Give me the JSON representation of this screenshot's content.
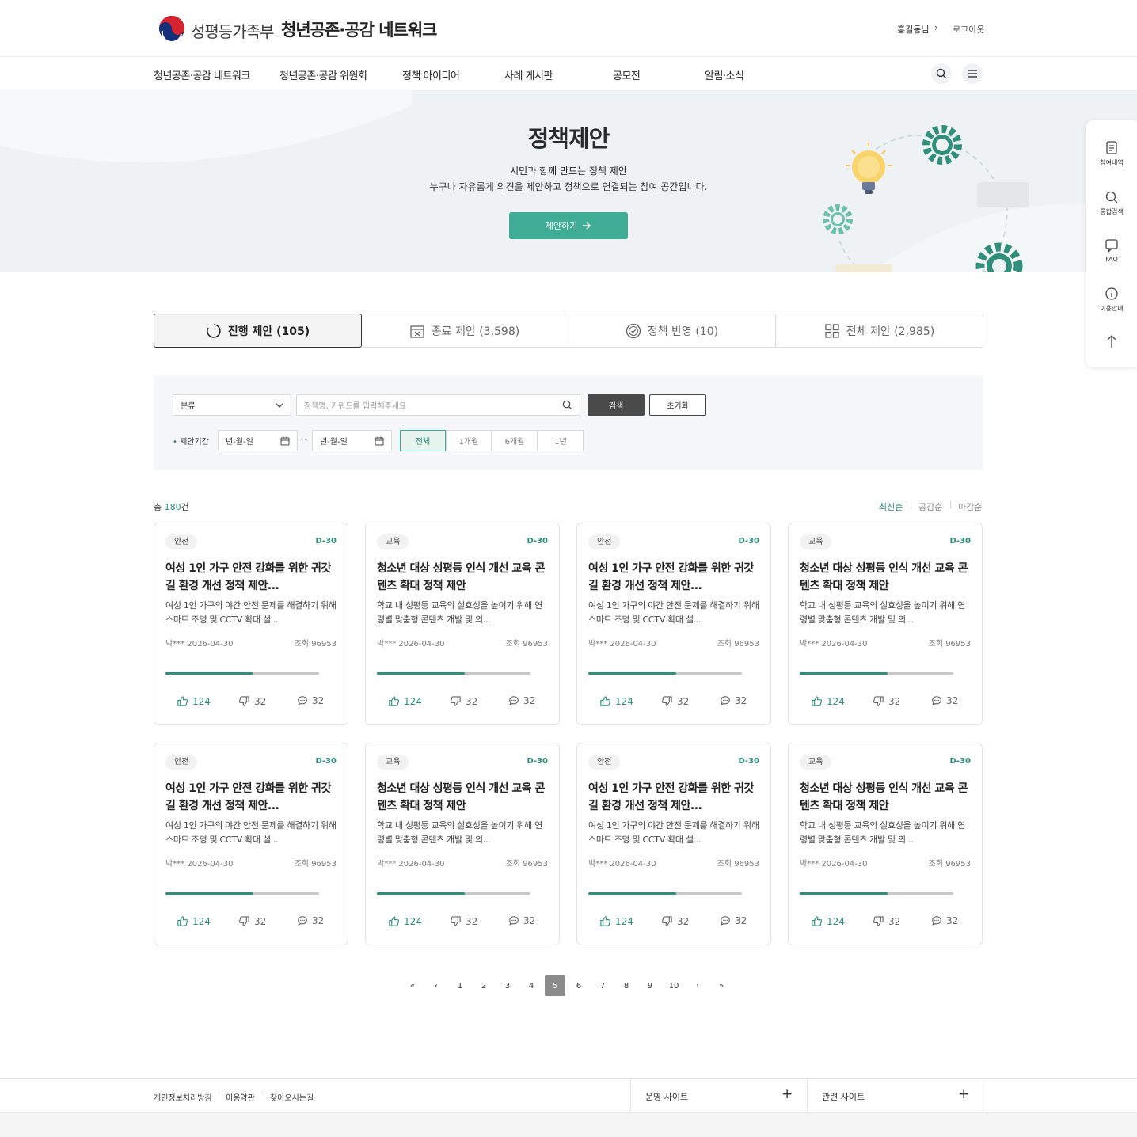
{
  "header": {
    "ministry": "성평등가족부",
    "site_title": "청년공존·공감 네트워크",
    "user": "홍길동님",
    "logout": "로그아웃"
  },
  "nav": {
    "items": [
      "청년공존·공감 네트워크",
      "청년공존·공감 위원회",
      "정책 아이디어",
      "사례 게시판",
      "공모전",
      "알림·소식"
    ]
  },
  "hero": {
    "title": "정책제안",
    "sub1": "시민과 함께 만드는 정책 제안",
    "sub2": "누구나 자유롭게 의견을 제안하고 정책으로 연결되는 참여 공간입니다.",
    "button": "제안하기"
  },
  "quick": {
    "items": [
      "참여내역",
      "통합검색",
      "FAQ",
      "이용안내"
    ]
  },
  "tabs": [
    {
      "label": "진행 제안 (105)",
      "icon": "progress-icon"
    },
    {
      "label": "종료 제안 (3,598)",
      "icon": "calendar-close-icon"
    },
    {
      "label": "정책 반영 (10)",
      "icon": "check-circle-icon"
    },
    {
      "label": "전체 제안 (2,985)",
      "icon": "grid-icon"
    }
  ],
  "search": {
    "category": "분류",
    "placeholder": "정책명, 키워드를 입력해주세요",
    "search_btn": "검색",
    "reset_btn": "초기화",
    "period_label": "제안기간",
    "date_from": "년-월-일",
    "tilde": "~",
    "date_to": "년-월-일",
    "periods": [
      "전체",
      "1개월",
      "6개월",
      "1년"
    ]
  },
  "list": {
    "total_prefix": "총 ",
    "total_count": "180",
    "total_suffix": "건",
    "sorts": [
      "최신순",
      "공감순",
      "마감순"
    ]
  },
  "cards": [
    {
      "badge": "안전",
      "dday": "D-30",
      "title": "여성 1인 가구 안전 강화를 위한 귀갓길 환경 개선 정책 제안...",
      "desc": "여성 1인 가구의 야간 안전 문제를 해결하기 위해 스마트 조명 및 CCTV 확대 설...",
      "author": "박***",
      "date": "2026-04-30",
      "views": "조회 96953",
      "progress": 0.57,
      "likes": "124",
      "dislikes": "32",
      "comments": "32"
    },
    {
      "badge": "교육",
      "dday": "D-30",
      "title": "청소년 대상 성평등 인식 개선 교육 콘텐츠 확대 정책 제안",
      "desc": "학교 내 성평등 교육의 실효성을 높이기 위해 연령별 맞춤형 콘텐츠 개발 및 의...",
      "author": "박***",
      "date": "2026-04-30",
      "views": "조회 96953",
      "progress": 0.57,
      "likes": "124",
      "dislikes": "32",
      "comments": "32"
    },
    {
      "badge": "안전",
      "dday": "D-30",
      "title": "여성 1인 가구 안전 강화를 위한 귀갓길 환경 개선 정책 제안...",
      "desc": "여성 1인 가구의 야간 안전 문제를 해결하기 위해 스마트 조명 및 CCTV 확대 설...",
      "author": "박***",
      "date": "2026-04-30",
      "views": "조회 96953",
      "progress": 0.57,
      "likes": "124",
      "dislikes": "32",
      "comments": "32"
    },
    {
      "badge": "교육",
      "dday": "D-30",
      "title": "청소년 대상 성평등 인식 개선 교육 콘텐츠 확대 정책 제안",
      "desc": "학교 내 성평등 교육의 실효성을 높이기 위해 연령별 맞춤형 콘텐츠 개발 및 의...",
      "author": "박***",
      "date": "2026-04-30",
      "views": "조회 96953",
      "progress": 0.57,
      "likes": "124",
      "dislikes": "32",
      "comments": "32"
    },
    {
      "badge": "안전",
      "dday": "D-30",
      "title": "여성 1인 가구 안전 강화를 위한 귀갓길 환경 개선 정책 제안...",
      "desc": "여성 1인 가구의 야간 안전 문제를 해결하기 위해 스마트 조명 및 CCTV 확대 설...",
      "author": "박***",
      "date": "2026-04-30",
      "views": "조회 96953",
      "progress": 0.57,
      "likes": "124",
      "dislikes": "32",
      "comments": "32"
    },
    {
      "badge": "교육",
      "dday": "D-30",
      "title": "청소년 대상 성평등 인식 개선 교육 콘텐츠 확대 정책 제안",
      "desc": "학교 내 성평등 교육의 실효성을 높이기 위해 연령별 맞춤형 콘텐츠 개발 및 의...",
      "author": "박***",
      "date": "2026-04-30",
      "views": "조회 96953",
      "progress": 0.57,
      "likes": "124",
      "dislikes": "32",
      "comments": "32"
    },
    {
      "badge": "안전",
      "dday": "D-30",
      "title": "여성 1인 가구 안전 강화를 위한 귀갓길 환경 개선 정책 제안...",
      "desc": "여성 1인 가구의 야간 안전 문제를 해결하기 위해 스마트 조명 및 CCTV 확대 설...",
      "author": "박***",
      "date": "2026-04-30",
      "views": "조회 96953",
      "progress": 0.57,
      "likes": "124",
      "dislikes": "32",
      "comments": "32"
    },
    {
      "badge": "교육",
      "dday": "D-30",
      "title": "청소년 대상 성평등 인식 개선 교육 콘텐츠 확대 정책 제안",
      "desc": "학교 내 성평등 교육의 실효성을 높이기 위해 연령별 맞춤형 콘텐츠 개발 및 의...",
      "author": "박***",
      "date": "2026-04-30",
      "views": "조회 96953",
      "progress": 0.57,
      "likes": "124",
      "dislikes": "32",
      "comments": "32"
    }
  ],
  "pagination": {
    "pages": [
      "1",
      "2",
      "3",
      "4",
      "5",
      "6",
      "7",
      "8",
      "9",
      "10"
    ],
    "current": "5",
    "first": "«",
    "prev": "‹",
    "next": "›",
    "last": "»"
  },
  "footer": {
    "links": [
      "개인정보처리방침",
      "이용약관",
      "찾아오시는길"
    ],
    "family_site": "운영 사이트",
    "related_site": "관련 사이트",
    "plus": "+"
  },
  "colors": {
    "accent": "#3fad95",
    "accent_dark": "#2c8d79"
  }
}
